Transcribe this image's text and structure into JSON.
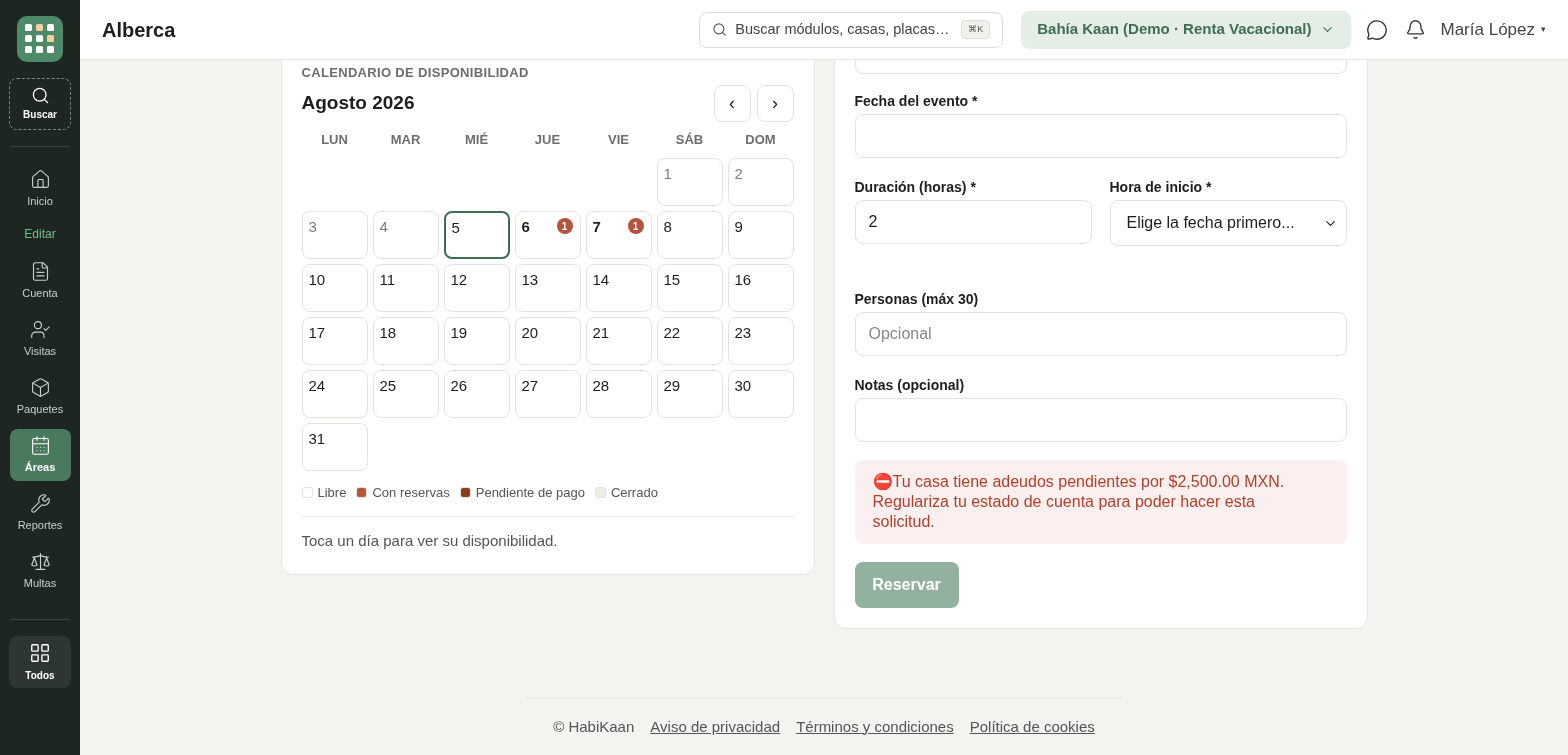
{
  "header": {
    "title": "Alberca",
    "search": {
      "placeholder": "Buscar módulos, casas, placas…",
      "shortcut": "⌘K"
    },
    "org": "Bahía Kaan (Demo · Renta Vacacional)",
    "user": "María López",
    "user_caret": "▾"
  },
  "sidebar": {
    "items": [
      {
        "kind": "search",
        "label": "Buscar",
        "selected": false
      },
      {
        "kind": "divider"
      },
      {
        "kind": "item",
        "label": "Inicio",
        "selected": false
      },
      {
        "kind": "section",
        "label": "Editar"
      },
      {
        "kind": "item",
        "label": "Cuenta",
        "selected": false
      },
      {
        "kind": "item",
        "label": "Visitas",
        "selected": false
      },
      {
        "kind": "item",
        "label": "Paquetes",
        "selected": false
      },
      {
        "kind": "item",
        "label": "Áreas",
        "selected": true
      },
      {
        "kind": "item",
        "label": "Reportes",
        "selected": false
      },
      {
        "kind": "item",
        "label": "Multas",
        "selected": false
      },
      {
        "kind": "divider"
      },
      {
        "kind": "all",
        "label": "Todos",
        "selected": false
      }
    ]
  },
  "calendar": {
    "heading": "CALENDARIO DE DISPONIBILIDAD",
    "month": "Agosto 2026",
    "prev": "‹",
    "next": "›",
    "weekdays": [
      "LUN",
      "MAR",
      "MIÉ",
      "JUE",
      "VIE",
      "SÁB",
      "DOM"
    ],
    "days": [
      {
        "kind": "blank"
      },
      {
        "kind": "blank"
      },
      {
        "kind": "blank"
      },
      {
        "kind": "blank"
      },
      {
        "kind": "blank"
      },
      {
        "kind": "day",
        "label": "1",
        "past": true,
        "selected": false
      },
      {
        "kind": "day",
        "label": "2",
        "past": true,
        "selected": false
      },
      {
        "kind": "day",
        "label": "3",
        "past": true,
        "selected": false
      },
      {
        "kind": "day",
        "label": "4",
        "past": true,
        "selected": false
      },
      {
        "kind": "day",
        "label": "5",
        "past": false,
        "selected": true
      },
      {
        "kind": "day",
        "label": "6",
        "past": false,
        "selected": false,
        "badge": "1",
        "color": "#b5533c"
      },
      {
        "kind": "day",
        "label": "7",
        "past": false,
        "selected": false,
        "badge": "1",
        "color": "#b5533c"
      },
      {
        "kind": "day",
        "label": "8",
        "past": false,
        "selected": false
      },
      {
        "kind": "day",
        "label": "9",
        "past": false,
        "selected": false
      },
      {
        "kind": "day",
        "label": "10",
        "past": false,
        "selected": false
      },
      {
        "kind": "day",
        "label": "11",
        "past": false,
        "selected": false
      },
      {
        "kind": "day",
        "label": "12",
        "past": false,
        "selected": false
      },
      {
        "kind": "day",
        "label": "13",
        "past": false,
        "selected": false
      },
      {
        "kind": "day",
        "label": "14",
        "past": false,
        "selected": false
      },
      {
        "kind": "day",
        "label": "15",
        "past": false,
        "selected": false
      },
      {
        "kind": "day",
        "label": "16",
        "past": false,
        "selected": false
      },
      {
        "kind": "day",
        "label": "17",
        "past": false,
        "selected": false
      },
      {
        "kind": "day",
        "label": "18",
        "past": false,
        "selected": false
      },
      {
        "kind": "day",
        "label": "19",
        "past": false,
        "selected": false
      },
      {
        "kind": "day",
        "label": "20",
        "past": false,
        "selected": false
      },
      {
        "kind": "day",
        "label": "21",
        "past": false,
        "selected": false
      },
      {
        "kind": "day",
        "label": "22",
        "past": false,
        "selected": false
      },
      {
        "kind": "day",
        "label": "23",
        "past": false,
        "selected": false
      },
      {
        "kind": "day",
        "label": "24",
        "past": false,
        "selected": false
      },
      {
        "kind": "day",
        "label": "25",
        "past": false,
        "selected": false
      },
      {
        "kind": "day",
        "label": "26",
        "past": false,
        "selected": false
      },
      {
        "kind": "day",
        "label": "27",
        "past": false,
        "selected": false
      },
      {
        "kind": "day",
        "label": "28",
        "past": false,
        "selected": false
      },
      {
        "kind": "day",
        "label": "29",
        "past": false,
        "selected": false
      },
      {
        "kind": "day",
        "label": "30",
        "past": false,
        "selected": false
      },
      {
        "kind": "day",
        "label": "31",
        "past": false,
        "selected": false
      }
    ],
    "legend": [
      {
        "label": "Libre",
        "color": "#ffffff"
      },
      {
        "label": "Con reservas",
        "color": "#c0533f"
      },
      {
        "label": "Pendiente de pago",
        "color": "#8a3d1e"
      },
      {
        "label": "Cerrado",
        "color": "#eeeeea"
      }
    ],
    "hint": "Toca un día para ver su disponibilidad."
  },
  "form": {
    "rows": [
      [
        {
          "kind": "input",
          "label": "Fecha del evento *"
        }
      ],
      [
        {
          "kind": "input",
          "label": "Duración (horas) *",
          "value": "2"
        },
        {
          "kind": "select",
          "label": "Hora de inicio *",
          "value": "Elige la fecha primero..."
        }
      ],
      [
        {
          "kind": "input",
          "label": "Personas (máx 30)",
          "placeholder": "Opcional"
        }
      ],
      [
        {
          "kind": "input",
          "label": "Notas (opcional)"
        }
      ]
    ],
    "alert": "⛔Tu casa tiene adeudos pendientes por $2,500.00 MXN. Regulariza tu estado de cuenta para poder hacer esta solicitud.",
    "submit": {
      "label": "Reservar",
      "disabled": true
    }
  },
  "footer": {
    "copyright": "© HabiKaan",
    "links": [
      "Aviso de privacidad",
      "Términos y condiciones",
      "Política de cookies"
    ]
  }
}
